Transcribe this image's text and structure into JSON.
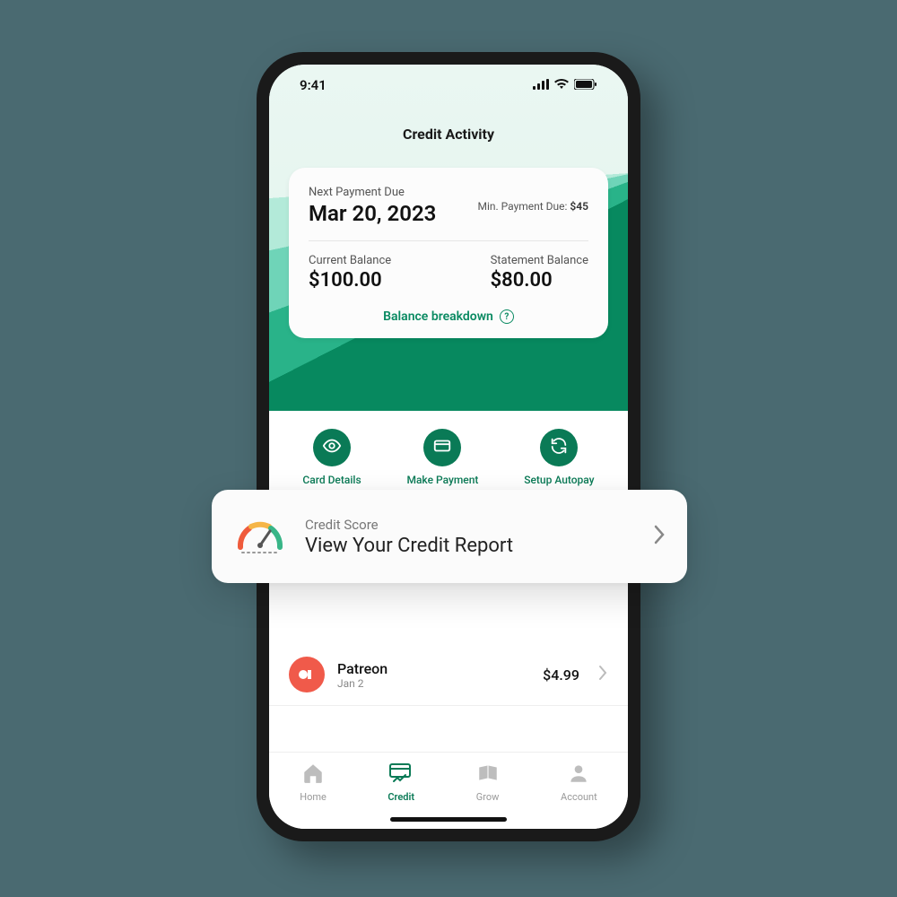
{
  "statusbar": {
    "time": "9:41"
  },
  "header": {
    "title": "Credit Activity"
  },
  "summary": {
    "next_payment_label": "Next Payment Due",
    "next_payment_date": "Mar 20, 2023",
    "min_due_label": "Min. Payment Due:",
    "min_due_value": "$45",
    "current_balance_label": "Current Balance",
    "current_balance_value": "$100.00",
    "statement_balance_label": "Statement Balance",
    "statement_balance_value": "$80.00",
    "breakdown_label": "Balance breakdown"
  },
  "actions": {
    "card_details": "Card Details",
    "make_payment": "Make Payment",
    "setup_autopay": "Setup Autopay"
  },
  "credit_score": {
    "label": "Credit Score",
    "title": "View Your Credit Report"
  },
  "transactions": [
    {
      "name": "Patreon",
      "date": "Jan 2",
      "amount": "$4.99"
    }
  ],
  "tabs": {
    "home": "Home",
    "credit": "Credit",
    "grow": "Grow",
    "account": "Account"
  }
}
